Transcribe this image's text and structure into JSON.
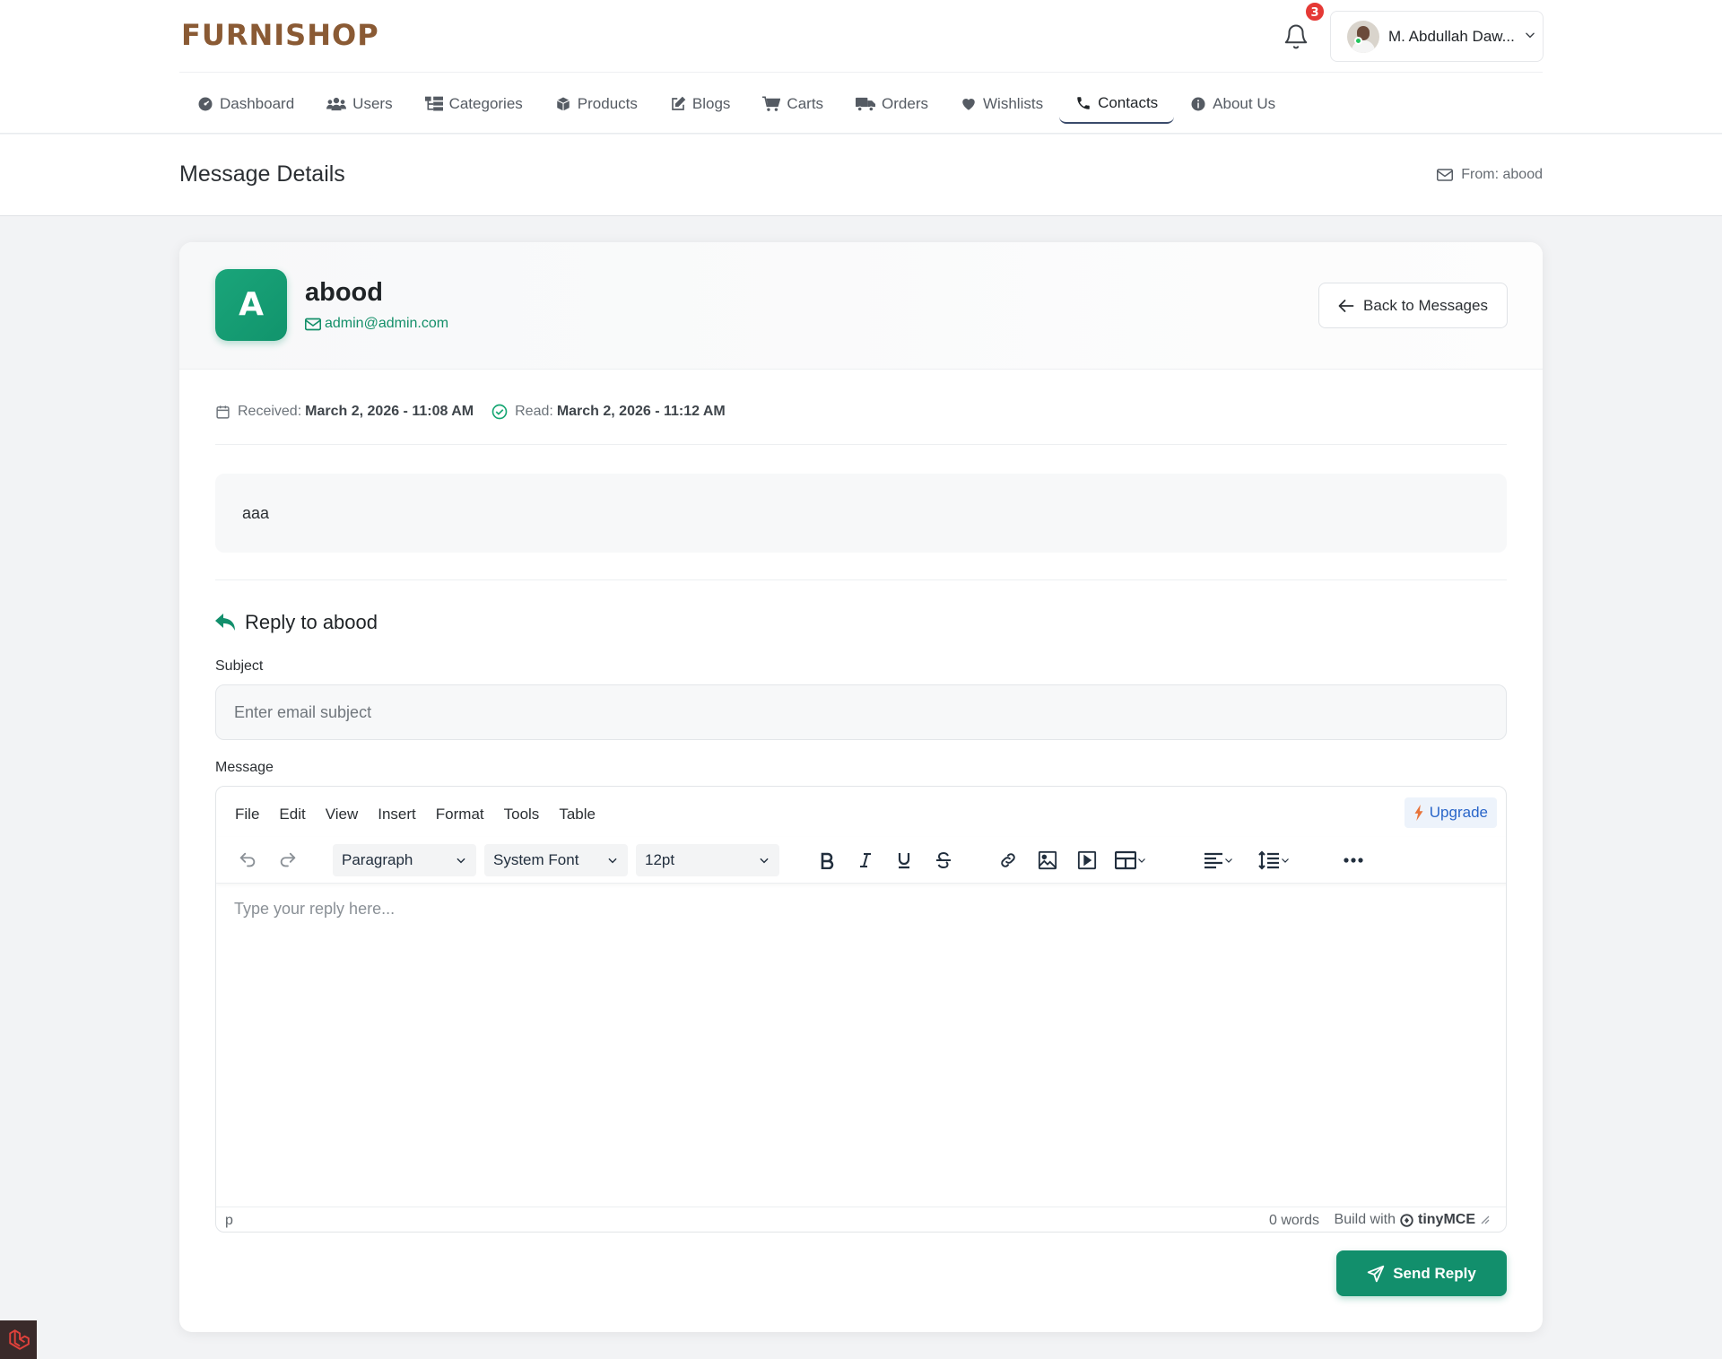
{
  "header": {
    "brand": "FURNISHOP",
    "notifications_count": "3",
    "user_name": "M. Abdullah Daw..."
  },
  "nav": {
    "items": [
      {
        "label": "Dashboard",
        "icon": "dashboard-icon"
      },
      {
        "label": "Users",
        "icon": "users-icon"
      },
      {
        "label": "Categories",
        "icon": "categories-icon"
      },
      {
        "label": "Products",
        "icon": "box-icon"
      },
      {
        "label": "Blogs",
        "icon": "edit-icon"
      },
      {
        "label": "Carts",
        "icon": "cart-icon"
      },
      {
        "label": "Orders",
        "icon": "truck-icon"
      },
      {
        "label": "Wishlists",
        "icon": "heart-icon"
      },
      {
        "label": "Contacts",
        "icon": "phone-icon",
        "active": true
      },
      {
        "label": "About Us",
        "icon": "info-icon"
      }
    ]
  },
  "page": {
    "title": "Message Details",
    "from_label": "From: abood"
  },
  "sender": {
    "initial": "A",
    "name": "abood",
    "email": "admin@admin.com"
  },
  "actions": {
    "back_label": "Back to Messages",
    "send_label": "Send Reply"
  },
  "meta": {
    "received_label": "Received:",
    "received_value": "March 2, 2026 - 11:08 AM",
    "read_label": "Read:",
    "read_value": "March 2, 2026 - 11:12 AM"
  },
  "message": {
    "body": "aaa"
  },
  "reply": {
    "title": "Reply to abood",
    "subject_label": "Subject",
    "subject_placeholder": "Enter email subject",
    "message_label": "Message"
  },
  "editor": {
    "menu": [
      "File",
      "Edit",
      "View",
      "Insert",
      "Format",
      "Tools",
      "Table"
    ],
    "upgrade_label": "Upgrade",
    "block_format": "Paragraph",
    "font_family": "System Font",
    "font_size": "12pt",
    "placeholder": "Type your reply here...",
    "status_path": "p",
    "word_count": "0 words",
    "built_with": "Build with",
    "brand": "tinyMCE"
  },
  "colors": {
    "accent": "#128f6c",
    "brand": "#8a5a34",
    "badge": "#e53935",
    "link": "#2a66c9"
  }
}
